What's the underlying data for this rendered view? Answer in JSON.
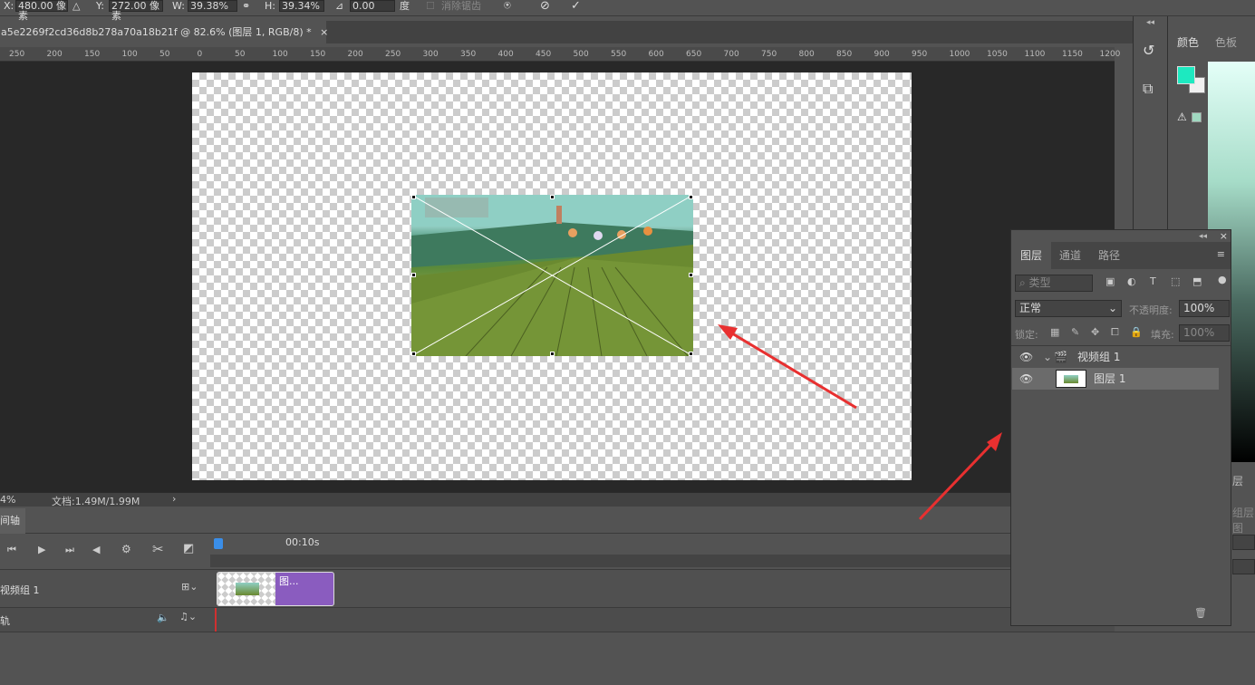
{
  "options": {
    "x_label": "X:",
    "x_value": "480.00 像素",
    "y_label": "Y:",
    "y_value": "272.00 像素",
    "w_label": "W:",
    "w_value": "39.38%",
    "h_label": "H:",
    "h_value": "39.34%",
    "angle_value": "0.00",
    "angle_unit": "度",
    "interp_label": "消除锯齿",
    "cancel_icon": "cancel-icon",
    "commit_icon": "commit-check-icon"
  },
  "document": {
    "tab_title": "a5e2269f2cd36d8b278a70a18b21f @ 82.6% (图层 1, RGB/8) *",
    "close_glyph": "×"
  },
  "ruler": {
    "ticks": [
      "250",
      "200",
      "150",
      "100",
      "50",
      "0",
      "50",
      "100",
      "150",
      "200",
      "250",
      "300",
      "350",
      "400",
      "450",
      "500",
      "550",
      "600",
      "650",
      "700",
      "750",
      "800",
      "850",
      "900",
      "950",
      "1000",
      "1050",
      "1100",
      "1150",
      "1200"
    ]
  },
  "status": {
    "zoom": "4%",
    "doc_info": "文档:1.49M/1.99M",
    "arrow": "›"
  },
  "timeline": {
    "tab_label": "间轴",
    "time_marker": "00:10s",
    "track1_name": "视频组 1",
    "clip_label": "图...",
    "track2_name": "轨"
  },
  "color_panel": {
    "tab_color": "颜色",
    "tab_swatches": "色板",
    "foreground": "#1de9c0",
    "background": "#f0f0f0",
    "warning_swatch": "#a0d8c0"
  },
  "layers_panel": {
    "tab_layers": "图层",
    "tab_channels": "通道",
    "tab_paths": "路径",
    "filter_placeholder": "类型",
    "blend_mode": "正常",
    "opacity_label": "不透明度:",
    "opacity_value": "100%",
    "lock_label": "锁定:",
    "fill_label": "填充:",
    "fill_value": "100%",
    "group_name": "视频组 1",
    "layer_name": "图层 1"
  },
  "side_fragments": {
    "frag1": "层",
    "frag2": "组层图"
  }
}
